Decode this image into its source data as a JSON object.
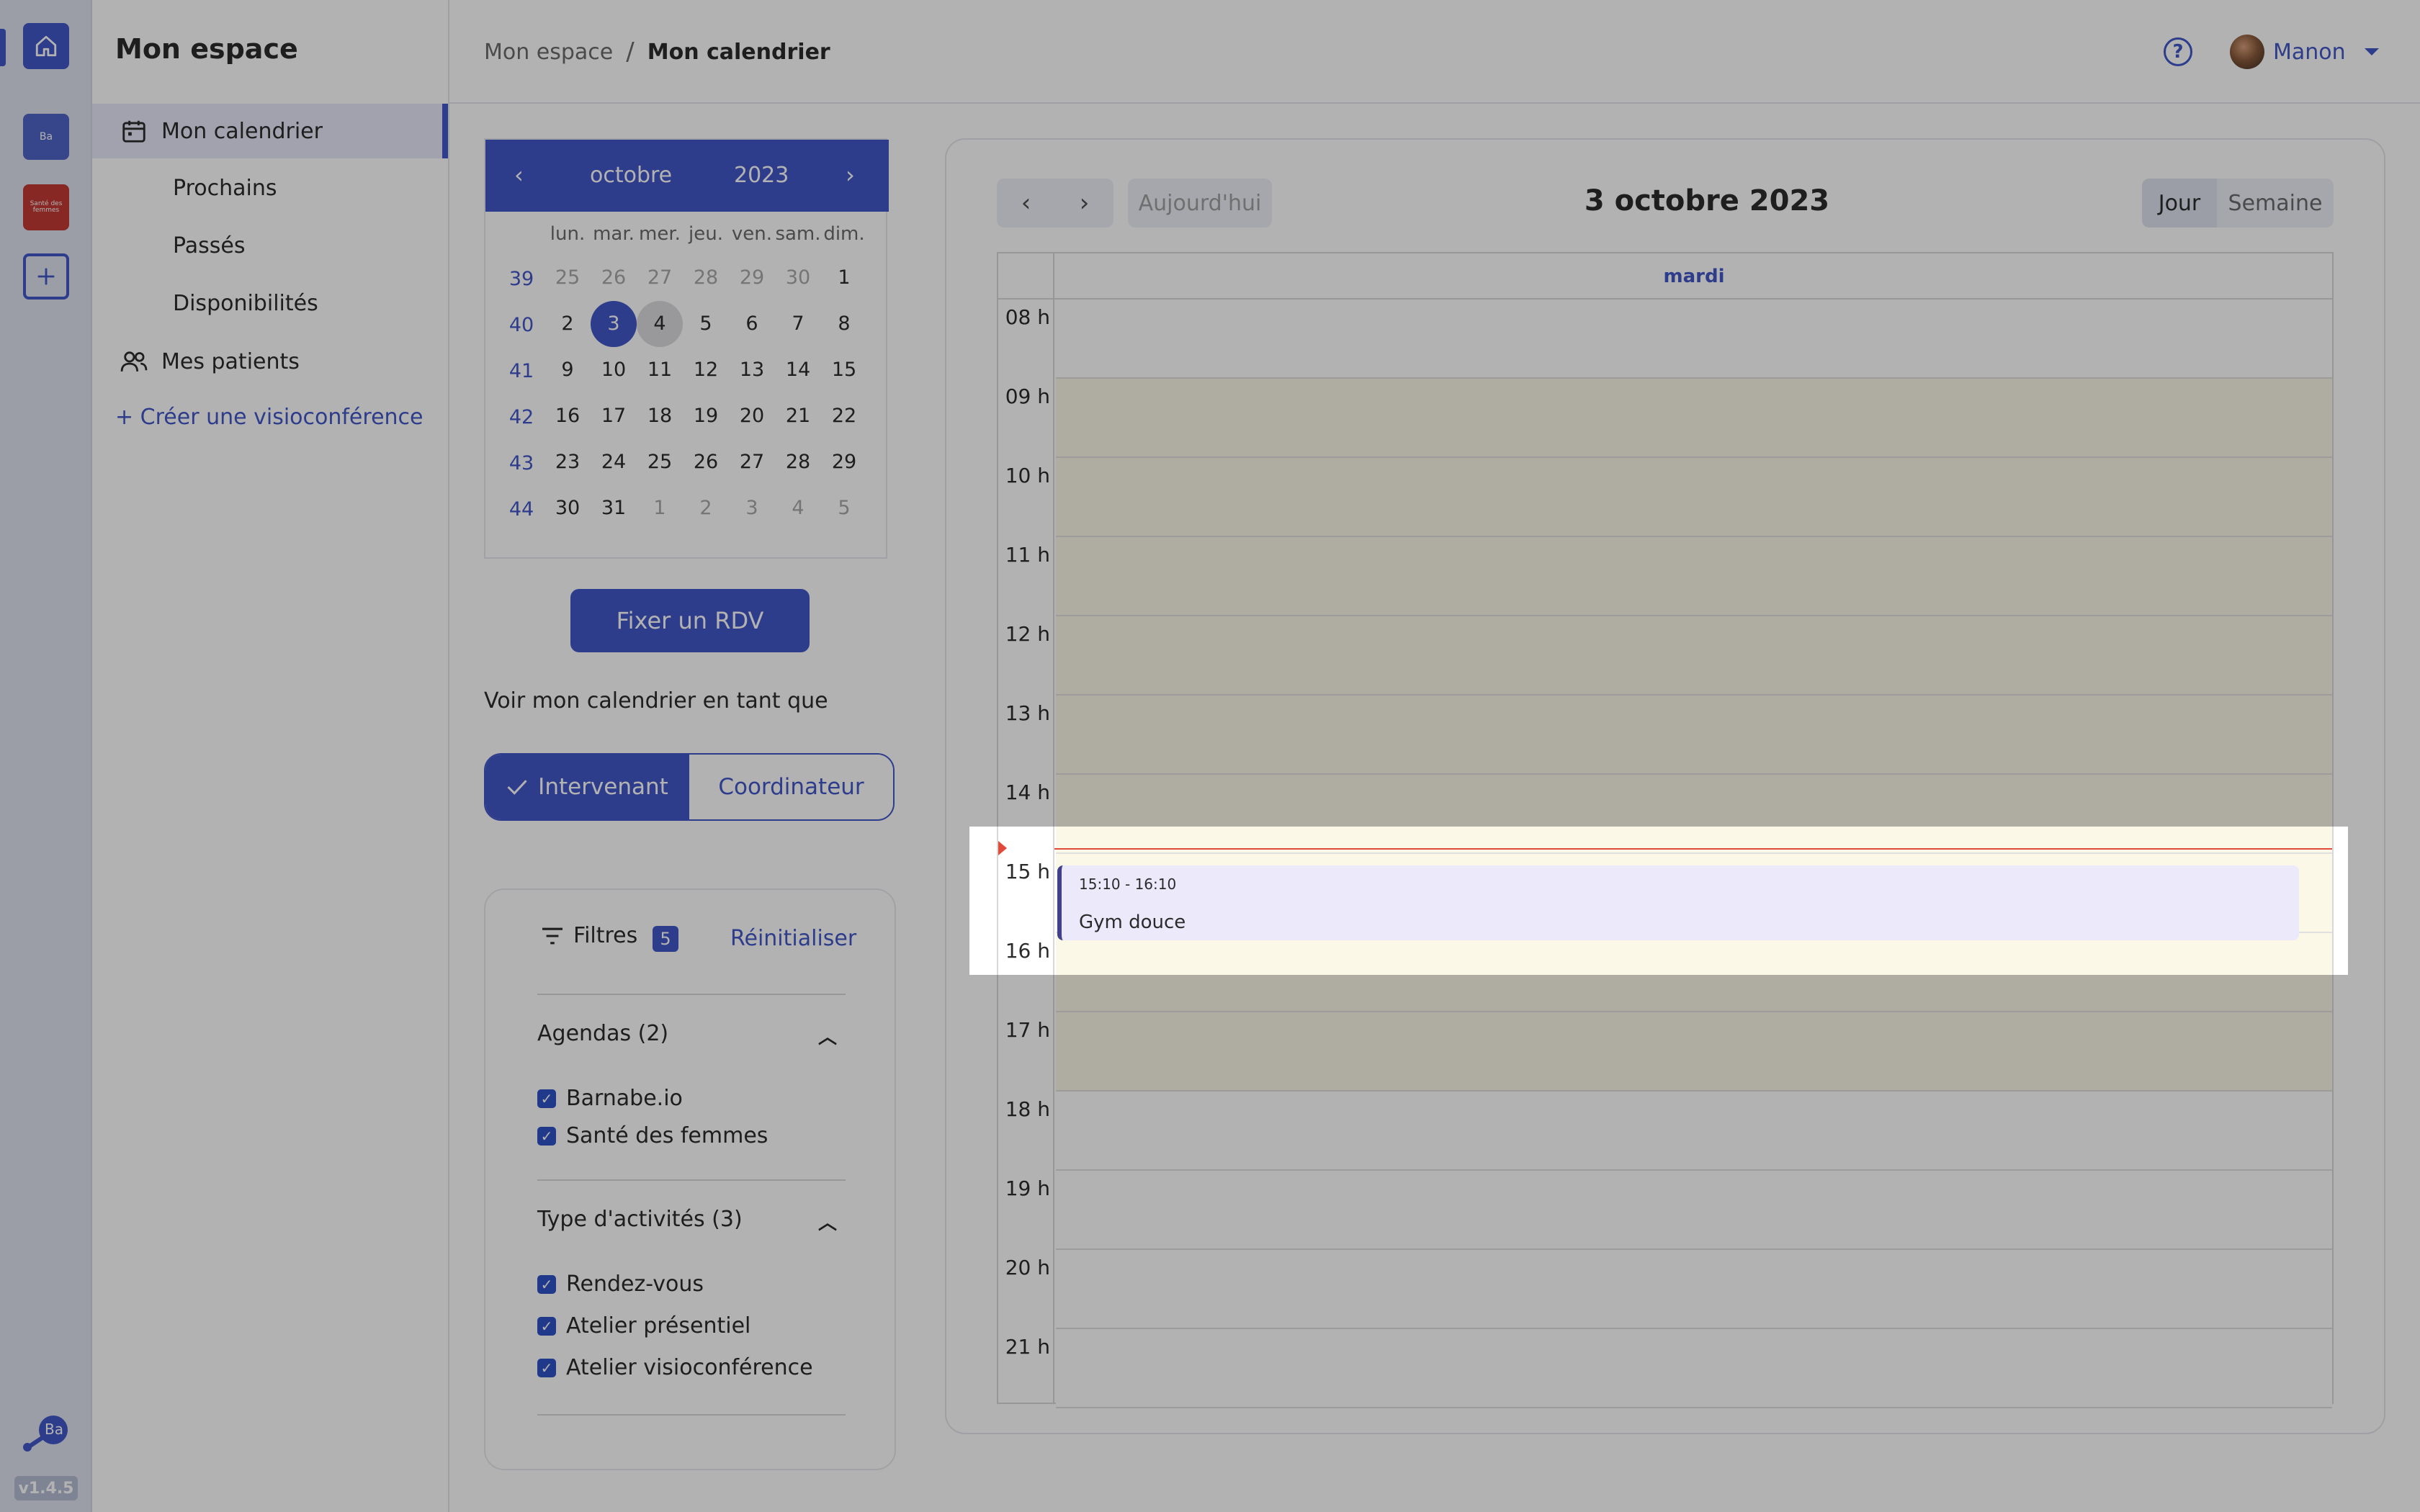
{
  "app": {
    "section_title": "Mon espace",
    "version": "v1.4.5"
  },
  "rail": {
    "app1_label": "Ba",
    "app2_label": "Santé des femmes",
    "footer_logo_label": "Ba"
  },
  "sidebar": {
    "items": [
      {
        "label": "Mon calendrier",
        "icon": "calendar-icon",
        "active": true
      },
      {
        "label": "Prochains"
      },
      {
        "label": "Passés"
      },
      {
        "label": "Disponibilités"
      },
      {
        "label": "Mes patients",
        "icon": "users-icon"
      }
    ],
    "create_link": "+ Créer une visioconférence"
  },
  "header": {
    "breadcrumb": [
      "Mon espace",
      "Mon calendrier"
    ],
    "breadcrumb_sep": "/",
    "help_icon": "?",
    "user_name": "Manon"
  },
  "minical": {
    "prev": "‹",
    "next": "›",
    "month": "octobre",
    "year": "2023",
    "weekdays": [
      "lun.",
      "mar.",
      "mer.",
      "jeu.",
      "ven.",
      "sam.",
      "dim."
    ],
    "weeks": [
      {
        "num": "39",
        "days": [
          "25",
          "26",
          "27",
          "28",
          "29",
          "30",
          "1"
        ],
        "muted": [
          0,
          1,
          2,
          3,
          4,
          5
        ]
      },
      {
        "num": "40",
        "days": [
          "2",
          "3",
          "4",
          "5",
          "6",
          "7",
          "8"
        ],
        "muted": []
      },
      {
        "num": "41",
        "days": [
          "9",
          "10",
          "11",
          "12",
          "13",
          "14",
          "15"
        ],
        "muted": []
      },
      {
        "num": "42",
        "days": [
          "16",
          "17",
          "18",
          "19",
          "20",
          "21",
          "22"
        ],
        "muted": []
      },
      {
        "num": "43",
        "days": [
          "23",
          "24",
          "25",
          "26",
          "27",
          "28",
          "29"
        ],
        "muted": []
      },
      {
        "num": "44",
        "days": [
          "30",
          "31",
          "1",
          "2",
          "3",
          "4",
          "5"
        ],
        "muted": [
          2,
          3,
          4,
          5,
          6
        ]
      }
    ],
    "selected": "3",
    "hovered": "4"
  },
  "actions": {
    "set_appointment": "Fixer un RDV",
    "view_as_label": "Voir mon calendrier en tant que",
    "role_options": [
      "Intervenant",
      "Coordinateur"
    ],
    "role_selected": "Intervenant"
  },
  "filters": {
    "title": "Filtres",
    "count": "5",
    "reset": "Réinitialiser",
    "sections": [
      {
        "title": "Agendas (2)",
        "items": [
          "Barnabe.io",
          "Santé des femmes"
        ]
      },
      {
        "title": "Type d'activités (3)",
        "items": [
          "Rendez-vous",
          "Atelier présentiel",
          "Atelier visioconférence"
        ]
      }
    ]
  },
  "calendar": {
    "today_label": "Aujourd'hui",
    "title": "3 octobre 2023",
    "views": [
      "Jour",
      "Semaine"
    ],
    "active_view": "Jour",
    "day_header": "mardi",
    "hours": [
      "08 h",
      "09 h",
      "10 h",
      "11 h",
      "12 h",
      "13 h",
      "14 h",
      "15 h",
      "16 h",
      "17 h",
      "18 h",
      "19 h",
      "20 h",
      "21 h"
    ],
    "events": [
      {
        "time": "15:10 - 16:10",
        "title": "Gym douce"
      }
    ],
    "colors": {
      "accent": "#4257c9",
      "now_line": "#e04a3a",
      "event_border": "#42408a",
      "event_bg": "#ece9fb"
    }
  }
}
